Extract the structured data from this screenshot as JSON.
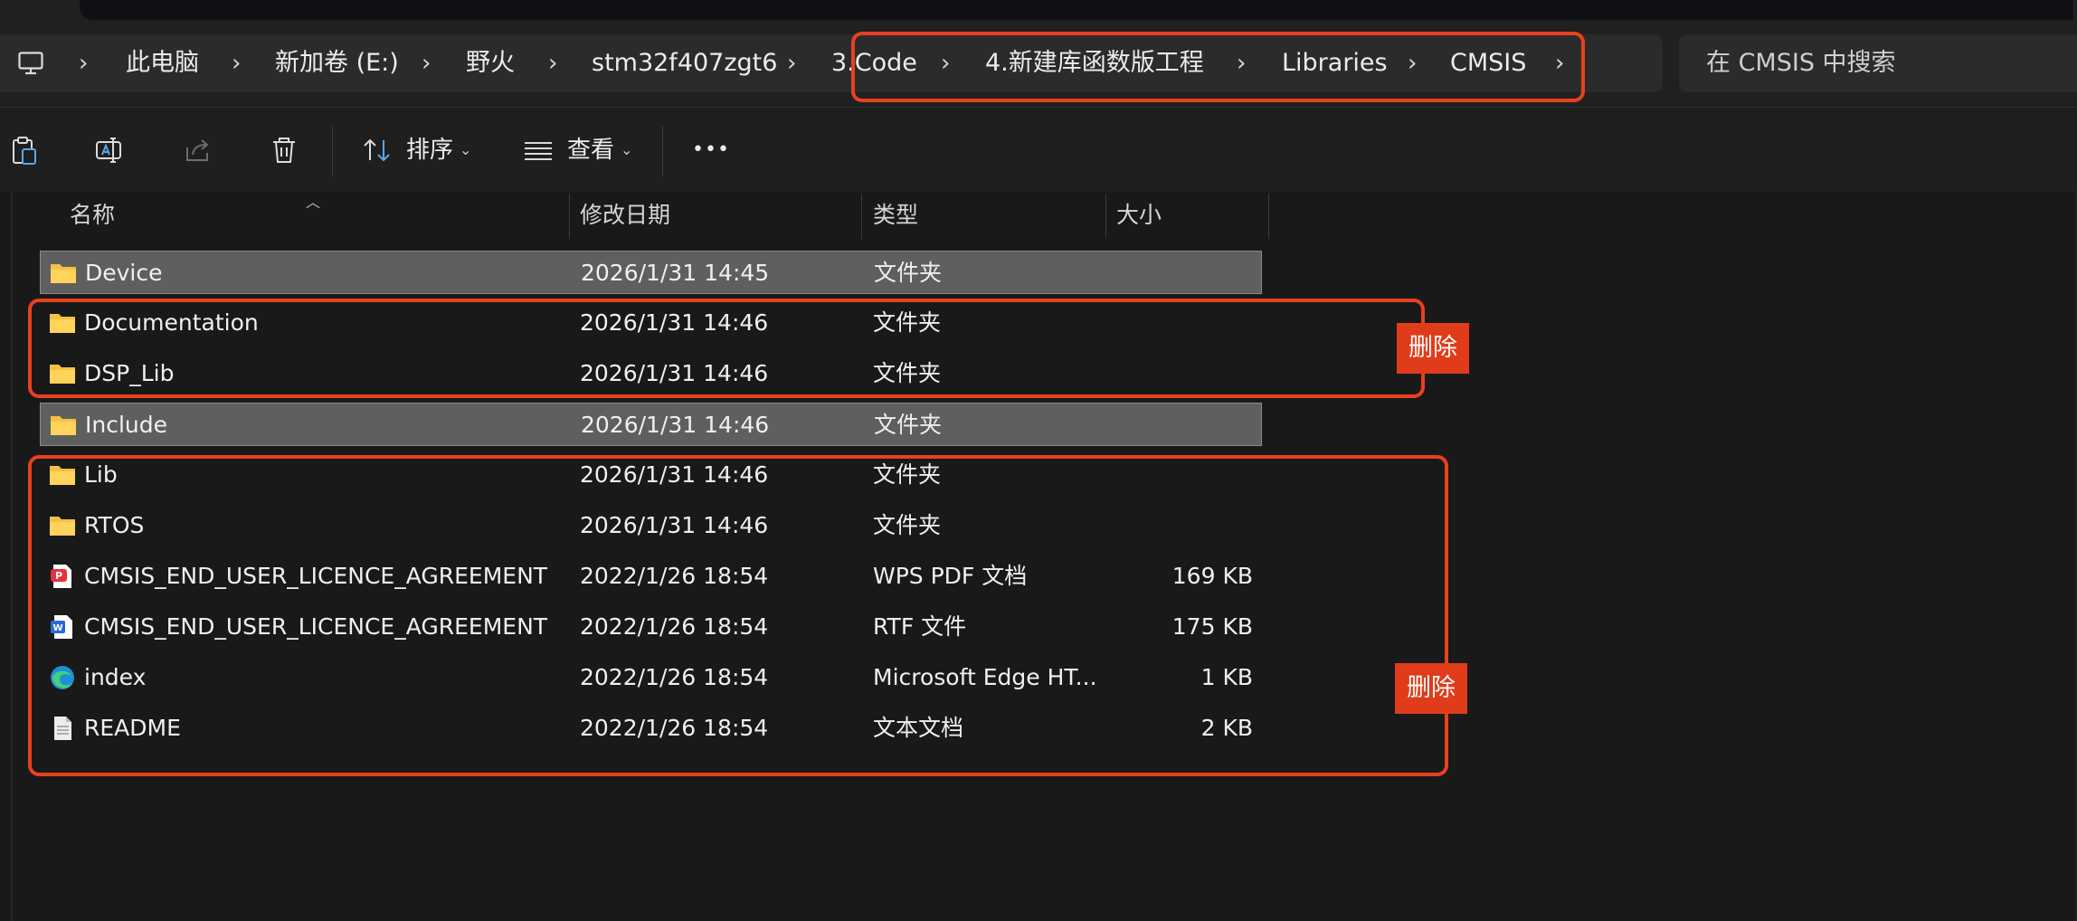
{
  "breadcrumb": {
    "items": [
      "此电脑",
      "新加卷 (E:)",
      "野火",
      "stm32f407zgt6",
      "3.Code",
      "4.新建库函数版工程",
      "Libraries",
      "CMSIS"
    ]
  },
  "search": {
    "placeholder": "在 CMSIS 中搜索"
  },
  "toolbar": {
    "sort_label": "排序",
    "view_label": "查看",
    "more_label": "•••"
  },
  "columns": {
    "name": "名称",
    "date": "修改日期",
    "type": "类型",
    "size": "大小"
  },
  "rows": [
    {
      "name": "Device",
      "date": "2026/1/31 14:45",
      "type": "文件夹",
      "size": "",
      "icon": "folder-icon",
      "selected": true
    },
    {
      "name": "Documentation",
      "date": "2026/1/31 14:46",
      "type": "文件夹",
      "size": "",
      "icon": "folder-icon",
      "selected": false
    },
    {
      "name": "DSP_Lib",
      "date": "2026/1/31 14:46",
      "type": "文件夹",
      "size": "",
      "icon": "folder-icon",
      "selected": false
    },
    {
      "name": "Include",
      "date": "2026/1/31 14:46",
      "type": "文件夹",
      "size": "",
      "icon": "folder-icon",
      "selected": true
    },
    {
      "name": "Lib",
      "date": "2026/1/31 14:46",
      "type": "文件夹",
      "size": "",
      "icon": "folder-icon",
      "selected": false
    },
    {
      "name": "RTOS",
      "date": "2026/1/31 14:46",
      "type": "文件夹",
      "size": "",
      "icon": "folder-icon",
      "selected": false
    },
    {
      "name": "CMSIS_END_USER_LICENCE_AGREEMENT",
      "date": "2022/1/26 18:54",
      "type": "WPS PDF 文档",
      "size": "169 KB",
      "icon": "pdf-icon",
      "selected": false
    },
    {
      "name": "CMSIS_END_USER_LICENCE_AGREEMENT",
      "date": "2022/1/26 18:54",
      "type": "RTF 文件",
      "size": "175 KB",
      "icon": "word-icon",
      "selected": false
    },
    {
      "name": "index",
      "date": "2022/1/26 18:54",
      "type": "Microsoft Edge HT...",
      "size": "1 KB",
      "icon": "edge-icon",
      "selected": false
    },
    {
      "name": "README",
      "date": "2022/1/26 18:54",
      "type": "文本文档",
      "size": "2 KB",
      "icon": "text-file-icon",
      "selected": false
    }
  ],
  "annotations": {
    "delete_label_1": "删除",
    "delete_label_2": "删除",
    "color": "#e8401f"
  },
  "colors": {
    "folder": "#f4c142",
    "selection": "#5f5f5f",
    "background": "#1b1b1b"
  }
}
